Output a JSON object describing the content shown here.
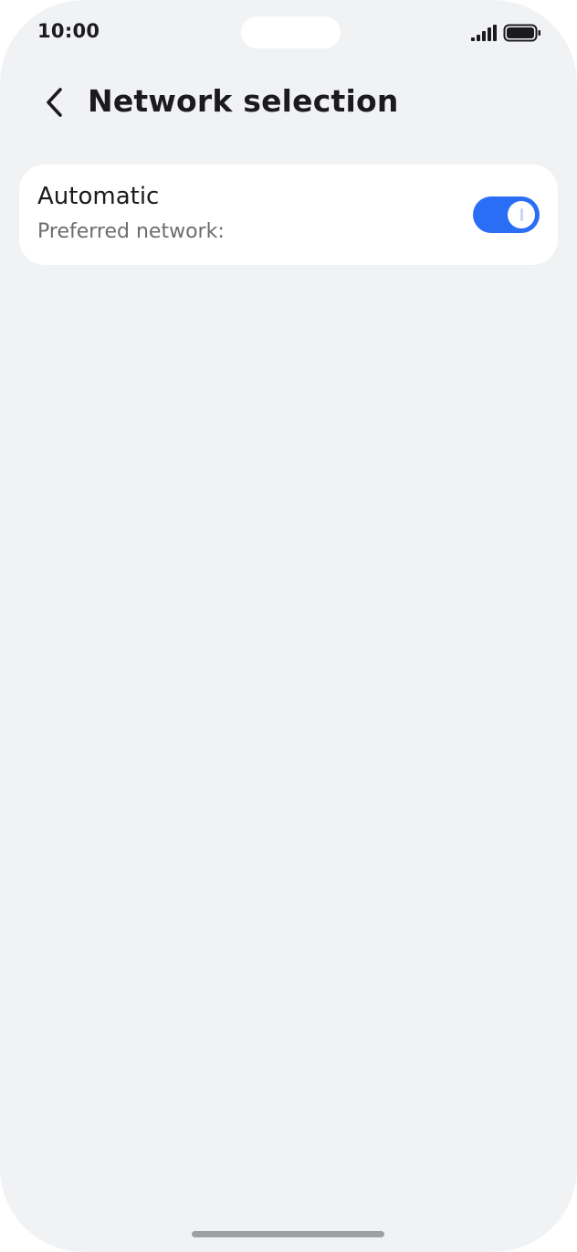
{
  "status_bar": {
    "time": "10:00",
    "signal_icon": "cellular-signal-icon",
    "battery_icon": "battery-full-icon"
  },
  "header": {
    "back_icon": "chevron-left-icon",
    "title": "Network selection"
  },
  "settings": {
    "automatic": {
      "title": "Automatic",
      "subtitle": "Preferred network:",
      "enabled": true
    }
  },
  "colors": {
    "background": "#f1f2f4",
    "card": "#ffffff",
    "accent": "#2b6ef6",
    "primary_text": "#1b1b1d",
    "secondary_text": "#6c6d70"
  }
}
